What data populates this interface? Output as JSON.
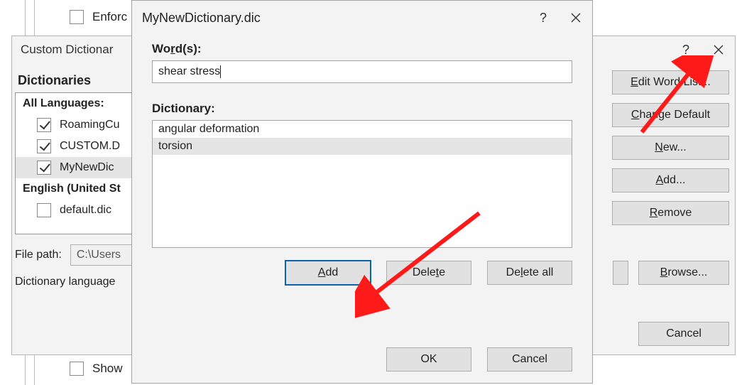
{
  "bg": {
    "enforce_label": "Enforc",
    "show_label": "Show"
  },
  "custom_dlg": {
    "title": "Custom Dictionar",
    "section_label": "Dictionaries",
    "all_languages": "All Languages:",
    "items": [
      {
        "label": "RoamingCu",
        "checked": true,
        "selected": false
      },
      {
        "label": "CUSTOM.D",
        "checked": true,
        "selected": false
      },
      {
        "label": "MyNewDic",
        "checked": true,
        "selected": true
      }
    ],
    "english_header": "English (United St",
    "default_item": "default.dic",
    "file_path_label": "File path:",
    "file_path_value": "C:\\Users",
    "dict_lang_label": "Dictionary language",
    "buttons": {
      "edit": "dit Word List...",
      "edit_prefix": "E",
      "change_default": "hange Default",
      "change_prefix": "C",
      "new": "ew...",
      "new_prefix": "N",
      "add": "dd...",
      "add_prefix": "A",
      "remove": "emove",
      "remove_prefix": "R",
      "browse": "rowse...",
      "browse_prefix": "B",
      "cancel": "Cancel"
    }
  },
  "edit_dlg": {
    "title": "MyNewDictionary.dic",
    "words_label": "Word(s):",
    "words_label_prefix": "Wo",
    "words_label_u": "r",
    "words_label_suffix": "d(s):",
    "word_value": "shear stress",
    "dict_label": "Dictionary:",
    "entries": [
      {
        "label": "angular deformation",
        "selected": false
      },
      {
        "label": "torsion",
        "selected": true
      }
    ],
    "buttons": {
      "add_prefix": "A",
      "add": "dd",
      "delete_pre": "Dele",
      "delete_u": "t",
      "delete_post": "e",
      "delall_pre": "De",
      "delall_u": "l",
      "delall_post": "ete all",
      "ok": "OK",
      "cancel": "Cancel"
    }
  }
}
